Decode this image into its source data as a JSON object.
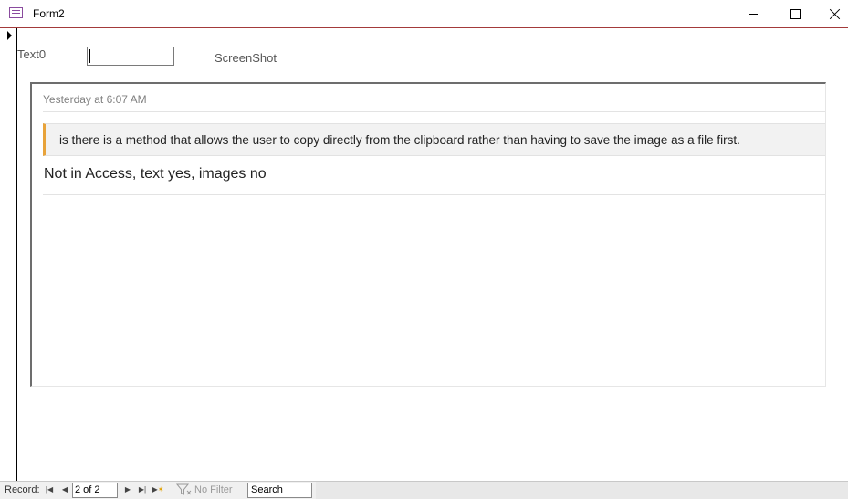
{
  "window": {
    "title": "Form2",
    "icons": {
      "app": "form-icon",
      "minimize": "minimize-icon",
      "maximize": "maximize-icon",
      "close": "close-icon"
    }
  },
  "form": {
    "text0_label": "Text0",
    "text0_value": "",
    "screenshot_label": "ScreenShot"
  },
  "screenshot": {
    "timestamp": "Yesterday at 6:07 AM",
    "quote": "is there is a method that allows the user to copy directly from the clipboard rather than having to save the image as a file first.",
    "reply": "Not in Access, text yes, images no",
    "accent_color": "#e8a33a"
  },
  "navigation": {
    "record_label": "Record:",
    "record_position": "2 of 2",
    "filter_label": "No Filter",
    "search_label": "Search",
    "icons": [
      "first-record-icon",
      "previous-record-icon",
      "next-record-icon",
      "last-record-icon",
      "new-record-icon",
      "filter-icon"
    ]
  }
}
